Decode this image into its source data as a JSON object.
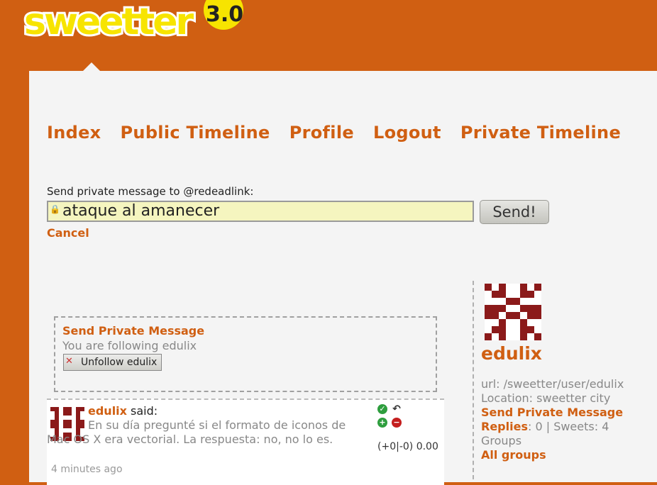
{
  "app": {
    "logo_text": "sweetter",
    "logo_version": "3.0"
  },
  "nav": [
    "Index",
    "Public Timeline",
    "Profile",
    "Logout",
    "Private Timeline"
  ],
  "private_message": {
    "label": "Send private message to @redeadlink:",
    "value": "ataque al amanecer",
    "send_label": "Send!",
    "cancel_label": "Cancel"
  },
  "follow_box": {
    "title": "Send Private Message",
    "status": "You are following edulix",
    "unfollow_label": "Unfollow edulix"
  },
  "sweet": {
    "user": "edulix",
    "said": "said:",
    "text": "En su día pregunté si el formato de iconos de Mac OS X era vectorial. La respuesta: no, no lo es.",
    "time": "4 minutes ago",
    "score": "(+0|-0) 0.00"
  },
  "profile": {
    "name": "edulix",
    "url": "url: /sweetter/user/edulix",
    "location": "Location: sweetter city",
    "send_pm": "Send Private Message",
    "replies_label": "Replies",
    "replies_count": ": 0",
    "sweets": " | Sweets: 4",
    "groups_label": "Groups",
    "all_groups": "All groups"
  },
  "colors": {
    "accent": "#d05f12",
    "panel": "#f4f4f4",
    "input_bg": "#f5f5bf",
    "avatar": "#8b1a1a"
  }
}
